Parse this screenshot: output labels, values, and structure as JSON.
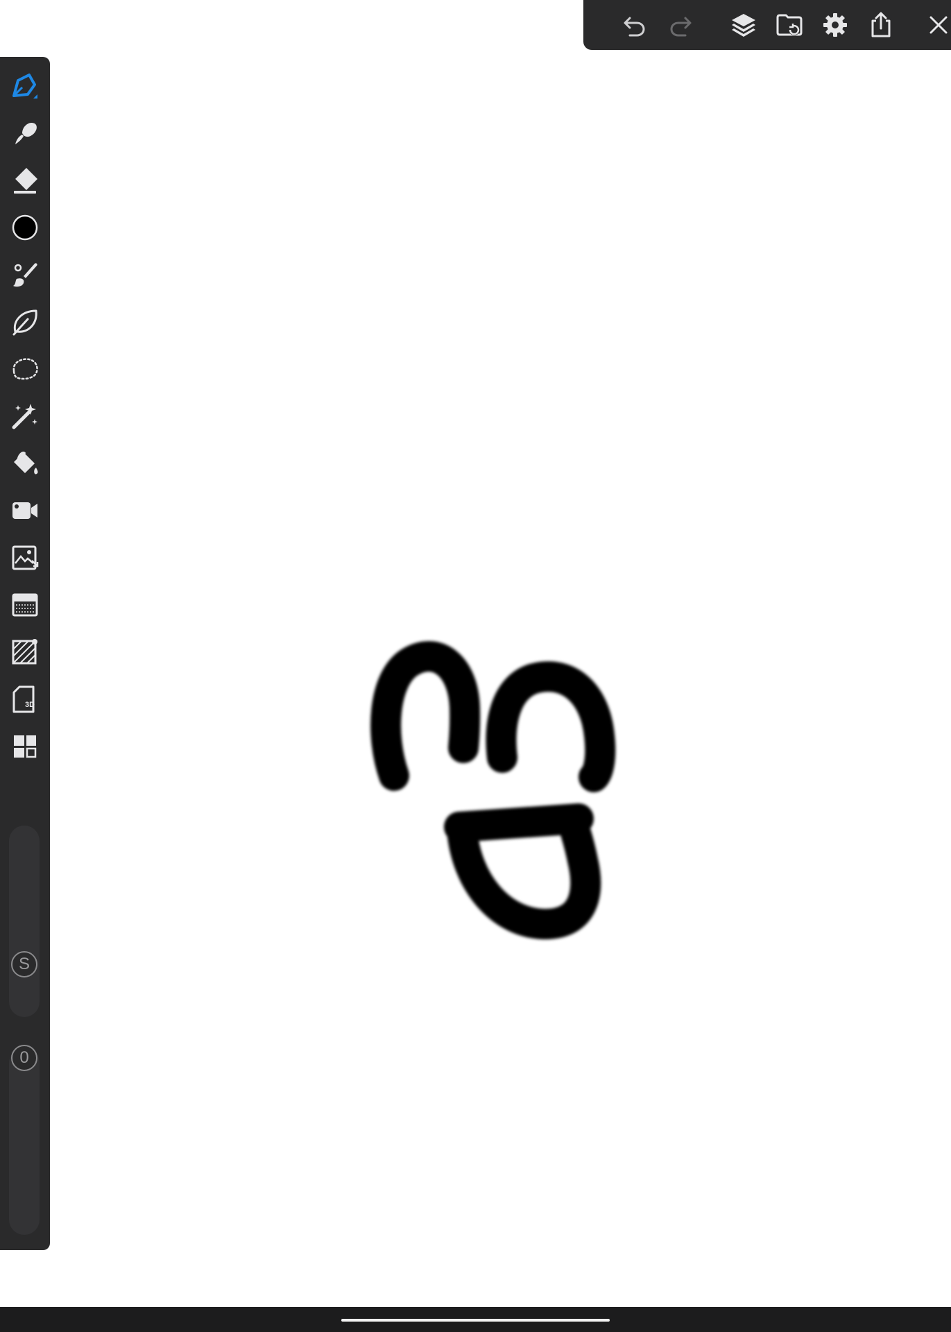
{
  "app": {
    "canvas_background": "#ffffff",
    "toolbar_background": "#2a2a2b",
    "accent": "#1e88e5"
  },
  "top_toolbar": {
    "buttons": [
      {
        "name": "undo-icon",
        "enabled": true
      },
      {
        "name": "redo-icon",
        "enabled": false
      },
      {
        "name": "layers-icon",
        "enabled": true
      },
      {
        "name": "gallery-folder-icon",
        "enabled": true
      },
      {
        "name": "settings-gear-icon",
        "enabled": true
      },
      {
        "name": "share-export-icon",
        "enabled": true
      },
      {
        "name": "close-icon",
        "enabled": true
      }
    ]
  },
  "left_toolbar": {
    "tools": [
      {
        "name": "pen-tool",
        "icon": "pen-nib-icon",
        "selected": true
      },
      {
        "name": "smudge-tool",
        "icon": "smudge-icon",
        "selected": false
      },
      {
        "name": "eraser-tool",
        "icon": "eraser-icon",
        "selected": false
      },
      {
        "name": "color-picker",
        "icon": "color-swatch",
        "selected": false,
        "color": "#000000"
      },
      {
        "name": "brush-tool",
        "icon": "brush-icon",
        "selected": false
      },
      {
        "name": "lasso-fill-tool",
        "icon": "leaf-lasso-icon",
        "selected": false
      },
      {
        "name": "selection-tool",
        "icon": "dotted-lasso-icon",
        "selected": false
      },
      {
        "name": "magic-wand-tool",
        "icon": "magic-wand-icon",
        "selected": false
      },
      {
        "name": "fill-bucket-tool",
        "icon": "paint-bucket-icon",
        "selected": false
      },
      {
        "name": "video-record-tool",
        "icon": "video-camera-icon",
        "selected": false
      },
      {
        "name": "image-import-tool",
        "icon": "image-import-icon",
        "selected": false
      },
      {
        "name": "texture-tool",
        "icon": "texture-icon",
        "selected": false
      },
      {
        "name": "perspective-guide-tool",
        "icon": "perspective-grid-icon",
        "selected": false
      },
      {
        "name": "3d-model-tool",
        "icon": "3d-document-icon",
        "selected": false,
        "badge": "3D"
      },
      {
        "name": "more-tools-grid",
        "icon": "grid-icon",
        "selected": false
      }
    ],
    "size_slider": {
      "badge": "S"
    },
    "opacity_slider": {
      "badge": "0"
    }
  },
  "drawing": {
    "stroke_color": "#000000",
    "description_of_content": ""
  },
  "system": {
    "home_indicator": true
  }
}
